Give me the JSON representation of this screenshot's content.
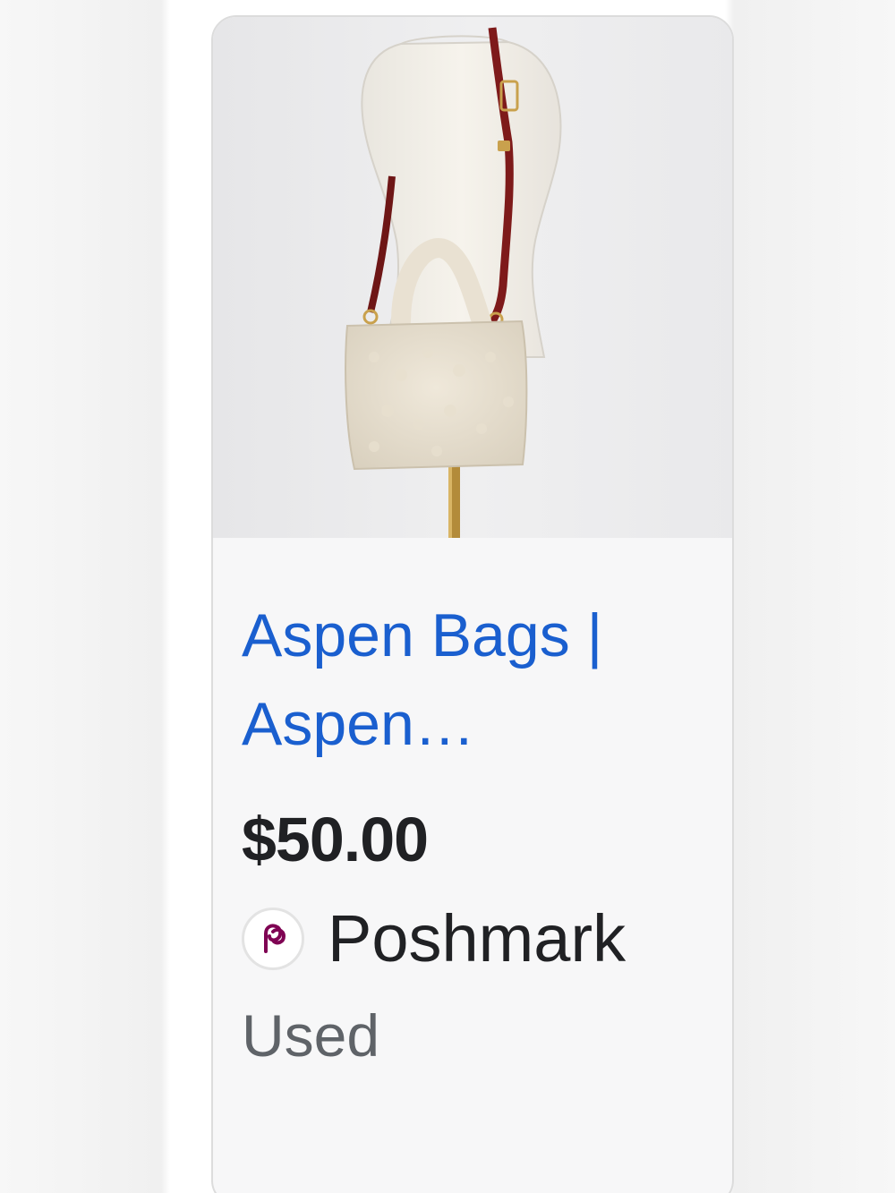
{
  "product": {
    "image_alt": "Cream sherpa tote bag with red leather crossbody strap on a mannequin",
    "title": "Aspen Bags | Aspen…",
    "price": "$50.00",
    "seller": {
      "name": "Poshmark",
      "logo_icon": "poshmark-logo-icon",
      "logo_color": "#7f0353"
    },
    "condition": "Used"
  },
  "colors": {
    "link": "#1a5fcf",
    "price": "#202124",
    "muted": "#5f6368",
    "card_bg": "#f7f7f8"
  }
}
